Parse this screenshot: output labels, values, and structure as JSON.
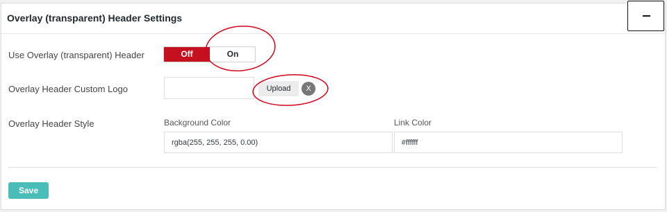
{
  "panel": {
    "title": "Overlay (transparent) Header Settings",
    "collapse_label": "−"
  },
  "fields": {
    "use_overlay": {
      "label": "Use Overlay (transparent) Header",
      "off_label": "Off",
      "on_label": "On",
      "selected": "Off"
    },
    "custom_logo": {
      "label": "Overlay Header Custom Logo",
      "value": "",
      "upload_label": "Upload",
      "clear_label": "X"
    },
    "header_style": {
      "label": "Overlay Header Style",
      "background_color": {
        "label": "Background Color",
        "value": "rgba(255, 255, 255, 0.00)"
      },
      "link_color": {
        "label": "Link Color",
        "value": "#ffffff"
      }
    }
  },
  "actions": {
    "save_label": "Save"
  },
  "colors": {
    "toggle_active": "#c5111f",
    "save_button": "#4bbdb9",
    "annotation": "#d0021b"
  }
}
